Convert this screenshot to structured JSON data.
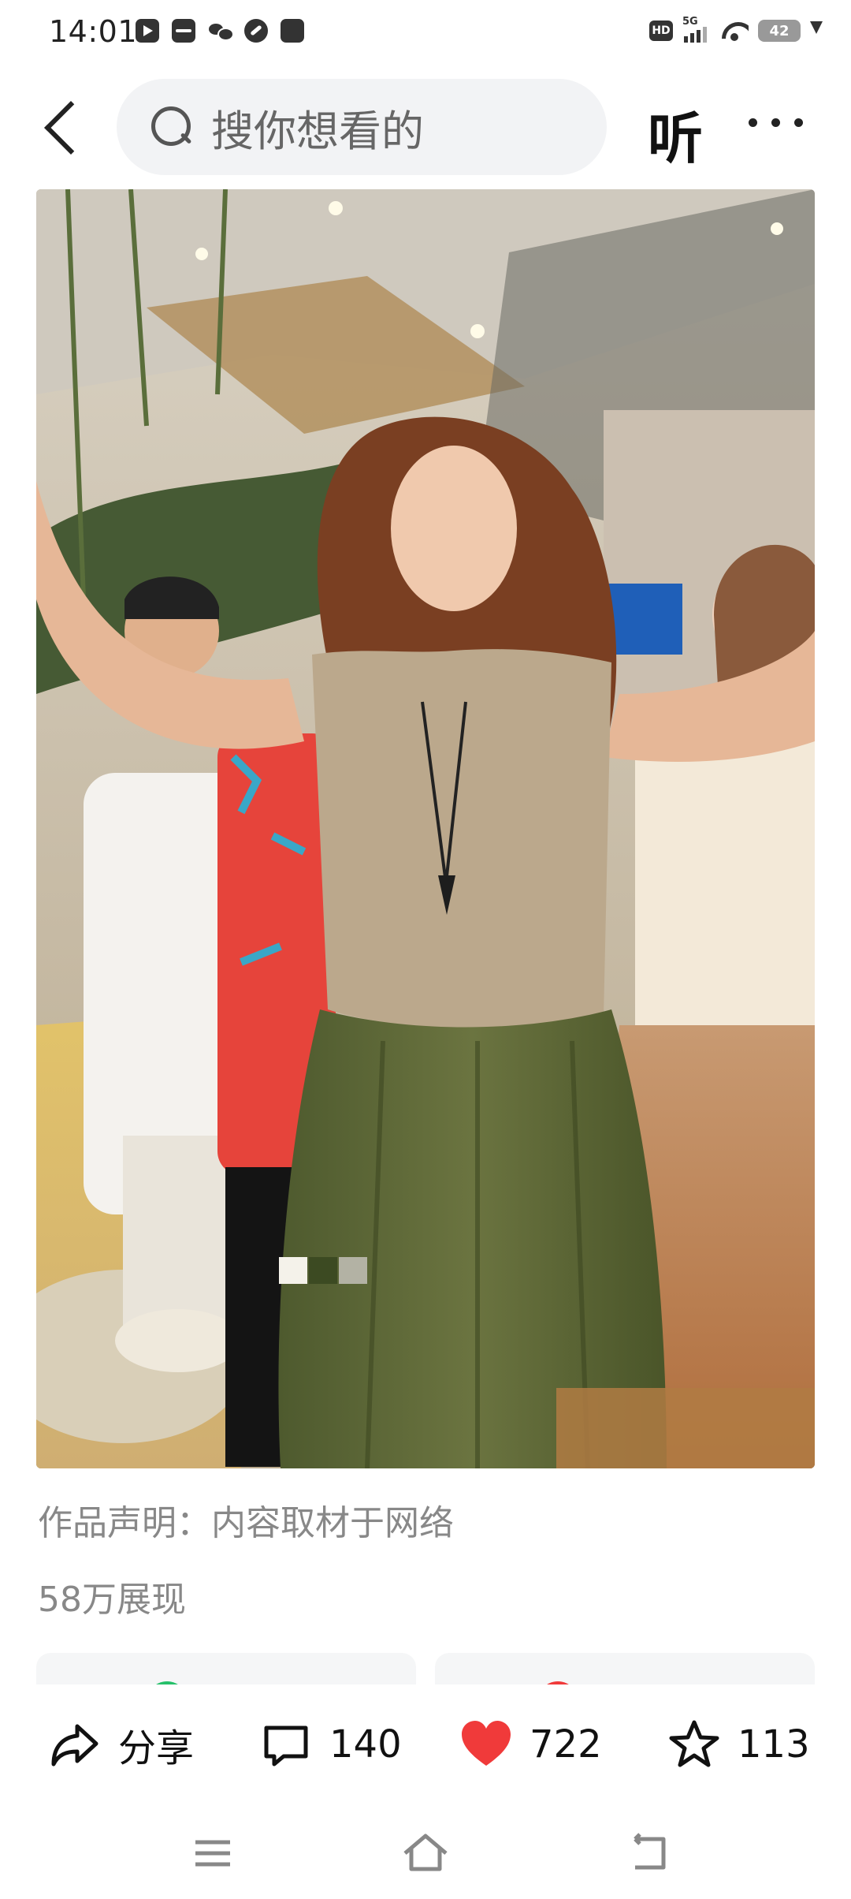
{
  "status_bar": {
    "time": "14:01",
    "network": "5G",
    "battery": "42"
  },
  "top_bar": {
    "search_placeholder": "搜你想看的",
    "listen_label": "听"
  },
  "video": {
    "watermark": ""
  },
  "meta": {
    "statement": "作品声明：内容取材于网络",
    "views": "58万展现"
  },
  "actions": {
    "share_label": "分享",
    "comment_count": "140",
    "like_count": "722",
    "favorite_count": "113"
  },
  "colors": {
    "like_red": "#f03a3a",
    "text_gray": "#888888",
    "search_bg": "#f2f3f5"
  }
}
